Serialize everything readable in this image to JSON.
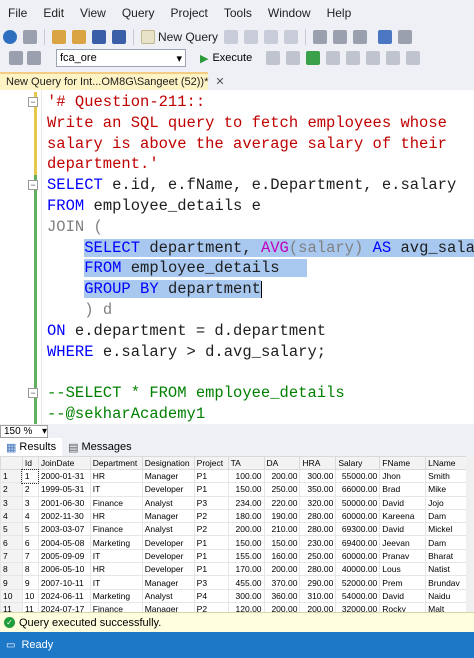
{
  "menu": [
    "File",
    "Edit",
    "View",
    "Query",
    "Project",
    "Tools",
    "Window",
    "Help"
  ],
  "toolbar": {
    "new_query_label": "New Query"
  },
  "toolbar2": {
    "database": "fca_ore",
    "execute_label": "Execute"
  },
  "tab": {
    "title": "New Query for Int...OM8G\\Sangeet (52))*"
  },
  "editor": {
    "lines": {
      "l1": "'# Question-211::",
      "l2": "Write an SQL query to fetch employees whose",
      "l3": "salary is above the average salary of their",
      "l4": "department.'",
      "l5a": "SELECT",
      "l5b": " e.id, e.fName, e.Department, e.salary",
      "l6a": "FROM",
      "l6b": " employee_details e",
      "l7a": "JOIN",
      "l7b": " (",
      "l8a": "SELECT",
      "l8b": " department, ",
      "l8c": "AVG",
      "l8d": "(salary) ",
      "l8e": "AS",
      "l8f": " avg_salary",
      "l9a": "FROM",
      "l9b": " employee_details",
      "l10a": "GROUP BY",
      "l10b": " department",
      "l11": ") d",
      "l12a": "ON",
      "l12b": " e.department = d.department",
      "l13a": "WHERE",
      "l13b": " e.salary > d.avg_salary;",
      "l14": "--SELECT * FROM employee_details",
      "l15": "--@sekharAcademy1"
    }
  },
  "zoom": "150 %",
  "results_tabs": {
    "results": "Results",
    "messages": "Messages"
  },
  "grid": {
    "columns": [
      "",
      "Id",
      "JoinDate",
      "Department",
      "Designation",
      "Project",
      "TA",
      "DA",
      "HRA",
      "Salary",
      "FName",
      "LName"
    ],
    "rows": [
      [
        "1",
        "1",
        "2000-01-31",
        "HR",
        "Manager",
        "P1",
        "100.00",
        "200.00",
        "300.00",
        "55000.00",
        "Jhon",
        "Smith"
      ],
      [
        "2",
        "2",
        "1999-05-31",
        "IT",
        "Developer",
        "P1",
        "150.00",
        "250.00",
        "350.00",
        "66000.00",
        "Brad",
        "Mike"
      ],
      [
        "3",
        "3",
        "2001-06-30",
        "Finance",
        "Analyst",
        "P3",
        "234.00",
        "220.00",
        "320.00",
        "50000.00",
        "David",
        "Jojo"
      ],
      [
        "4",
        "4",
        "2002-11-30",
        "HR",
        "Manager",
        "P2",
        "180.00",
        "190.00",
        "280.00",
        "60000.00",
        "Kareena",
        "Dam"
      ],
      [
        "5",
        "5",
        "2003-03-07",
        "Finance",
        "Analyst",
        "P2",
        "200.00",
        "210.00",
        "280.00",
        "69300.00",
        "David",
        "Mickel"
      ],
      [
        "6",
        "6",
        "2004-05-08",
        "Marketing",
        "Developer",
        "P1",
        "150.00",
        "150.00",
        "230.00",
        "69400.00",
        "Jeevan",
        "Dam"
      ],
      [
        "7",
        "7",
        "2005-09-09",
        "IT",
        "Developer",
        "P1",
        "155.00",
        "160.00",
        "250.00",
        "60000.00",
        "Pranav",
        "Bharat"
      ],
      [
        "8",
        "8",
        "2006-05-10",
        "HR",
        "Developer",
        "P1",
        "170.00",
        "200.00",
        "280.00",
        "40000.00",
        "Lous",
        "Natist"
      ],
      [
        "9",
        "9",
        "2007-10-11",
        "IT",
        "Manager",
        "P3",
        "455.00",
        "370.00",
        "290.00",
        "52000.00",
        "Prem",
        "Brundav"
      ],
      [
        "10",
        "10",
        "2024-06-11",
        "Marketing",
        "Analyst",
        "P4",
        "300.00",
        "360.00",
        "310.00",
        "54000.00",
        "David",
        "Naidu"
      ],
      [
        "11",
        "11",
        "2024-07-17",
        "Finance",
        "Manager",
        "P2",
        "120.00",
        "200.00",
        "200.00",
        "32000.00",
        "Rocky",
        "Malt"
      ]
    ]
  },
  "status": {
    "message": "Query executed successfully.",
    "bar": "Ready"
  }
}
